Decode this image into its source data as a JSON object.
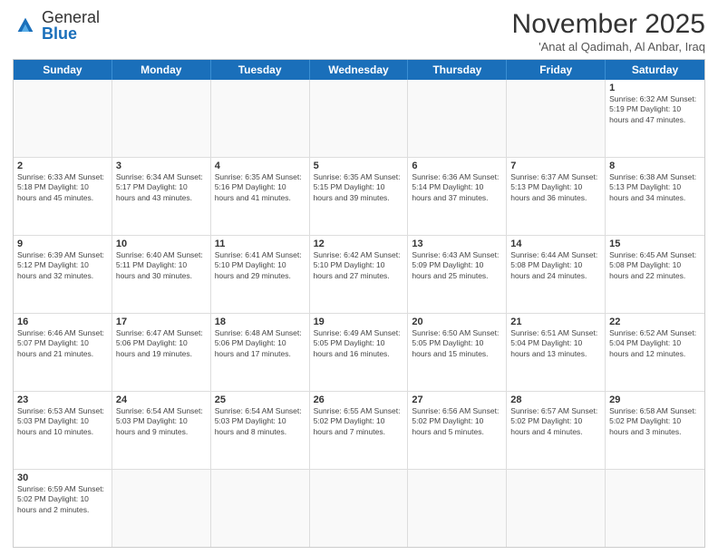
{
  "header": {
    "logo_general": "General",
    "logo_blue": "Blue",
    "month_title": "November 2025",
    "location": "'Anat al Qadimah, Al Anbar, Iraq"
  },
  "day_headers": [
    "Sunday",
    "Monday",
    "Tuesday",
    "Wednesday",
    "Thursday",
    "Friday",
    "Saturday"
  ],
  "weeks": [
    [
      {
        "num": "",
        "info": "",
        "empty": true
      },
      {
        "num": "",
        "info": "",
        "empty": true
      },
      {
        "num": "",
        "info": "",
        "empty": true
      },
      {
        "num": "",
        "info": "",
        "empty": true
      },
      {
        "num": "",
        "info": "",
        "empty": true
      },
      {
        "num": "",
        "info": "",
        "empty": true
      },
      {
        "num": "1",
        "info": "Sunrise: 6:32 AM\nSunset: 5:19 PM\nDaylight: 10 hours and 47 minutes.",
        "empty": false
      }
    ],
    [
      {
        "num": "2",
        "info": "Sunrise: 6:33 AM\nSunset: 5:18 PM\nDaylight: 10 hours and 45 minutes.",
        "empty": false
      },
      {
        "num": "3",
        "info": "Sunrise: 6:34 AM\nSunset: 5:17 PM\nDaylight: 10 hours and 43 minutes.",
        "empty": false
      },
      {
        "num": "4",
        "info": "Sunrise: 6:35 AM\nSunset: 5:16 PM\nDaylight: 10 hours and 41 minutes.",
        "empty": false
      },
      {
        "num": "5",
        "info": "Sunrise: 6:35 AM\nSunset: 5:15 PM\nDaylight: 10 hours and 39 minutes.",
        "empty": false
      },
      {
        "num": "6",
        "info": "Sunrise: 6:36 AM\nSunset: 5:14 PM\nDaylight: 10 hours and 37 minutes.",
        "empty": false
      },
      {
        "num": "7",
        "info": "Sunrise: 6:37 AM\nSunset: 5:13 PM\nDaylight: 10 hours and 36 minutes.",
        "empty": false
      },
      {
        "num": "8",
        "info": "Sunrise: 6:38 AM\nSunset: 5:13 PM\nDaylight: 10 hours and 34 minutes.",
        "empty": false
      }
    ],
    [
      {
        "num": "9",
        "info": "Sunrise: 6:39 AM\nSunset: 5:12 PM\nDaylight: 10 hours and 32 minutes.",
        "empty": false
      },
      {
        "num": "10",
        "info": "Sunrise: 6:40 AM\nSunset: 5:11 PM\nDaylight: 10 hours and 30 minutes.",
        "empty": false
      },
      {
        "num": "11",
        "info": "Sunrise: 6:41 AM\nSunset: 5:10 PM\nDaylight: 10 hours and 29 minutes.",
        "empty": false
      },
      {
        "num": "12",
        "info": "Sunrise: 6:42 AM\nSunset: 5:10 PM\nDaylight: 10 hours and 27 minutes.",
        "empty": false
      },
      {
        "num": "13",
        "info": "Sunrise: 6:43 AM\nSunset: 5:09 PM\nDaylight: 10 hours and 25 minutes.",
        "empty": false
      },
      {
        "num": "14",
        "info": "Sunrise: 6:44 AM\nSunset: 5:08 PM\nDaylight: 10 hours and 24 minutes.",
        "empty": false
      },
      {
        "num": "15",
        "info": "Sunrise: 6:45 AM\nSunset: 5:08 PM\nDaylight: 10 hours and 22 minutes.",
        "empty": false
      }
    ],
    [
      {
        "num": "16",
        "info": "Sunrise: 6:46 AM\nSunset: 5:07 PM\nDaylight: 10 hours and 21 minutes.",
        "empty": false
      },
      {
        "num": "17",
        "info": "Sunrise: 6:47 AM\nSunset: 5:06 PM\nDaylight: 10 hours and 19 minutes.",
        "empty": false
      },
      {
        "num": "18",
        "info": "Sunrise: 6:48 AM\nSunset: 5:06 PM\nDaylight: 10 hours and 17 minutes.",
        "empty": false
      },
      {
        "num": "19",
        "info": "Sunrise: 6:49 AM\nSunset: 5:05 PM\nDaylight: 10 hours and 16 minutes.",
        "empty": false
      },
      {
        "num": "20",
        "info": "Sunrise: 6:50 AM\nSunset: 5:05 PM\nDaylight: 10 hours and 15 minutes.",
        "empty": false
      },
      {
        "num": "21",
        "info": "Sunrise: 6:51 AM\nSunset: 5:04 PM\nDaylight: 10 hours and 13 minutes.",
        "empty": false
      },
      {
        "num": "22",
        "info": "Sunrise: 6:52 AM\nSunset: 5:04 PM\nDaylight: 10 hours and 12 minutes.",
        "empty": false
      }
    ],
    [
      {
        "num": "23",
        "info": "Sunrise: 6:53 AM\nSunset: 5:03 PM\nDaylight: 10 hours and 10 minutes.",
        "empty": false
      },
      {
        "num": "24",
        "info": "Sunrise: 6:54 AM\nSunset: 5:03 PM\nDaylight: 10 hours and 9 minutes.",
        "empty": false
      },
      {
        "num": "25",
        "info": "Sunrise: 6:54 AM\nSunset: 5:03 PM\nDaylight: 10 hours and 8 minutes.",
        "empty": false
      },
      {
        "num": "26",
        "info": "Sunrise: 6:55 AM\nSunset: 5:02 PM\nDaylight: 10 hours and 7 minutes.",
        "empty": false
      },
      {
        "num": "27",
        "info": "Sunrise: 6:56 AM\nSunset: 5:02 PM\nDaylight: 10 hours and 5 minutes.",
        "empty": false
      },
      {
        "num": "28",
        "info": "Sunrise: 6:57 AM\nSunset: 5:02 PM\nDaylight: 10 hours and 4 minutes.",
        "empty": false
      },
      {
        "num": "29",
        "info": "Sunrise: 6:58 AM\nSunset: 5:02 PM\nDaylight: 10 hours and 3 minutes.",
        "empty": false
      }
    ],
    [
      {
        "num": "30",
        "info": "Sunrise: 6:59 AM\nSunset: 5:02 PM\nDaylight: 10 hours and 2 minutes.",
        "empty": false
      },
      {
        "num": "",
        "info": "",
        "empty": true
      },
      {
        "num": "",
        "info": "",
        "empty": true
      },
      {
        "num": "",
        "info": "",
        "empty": true
      },
      {
        "num": "",
        "info": "",
        "empty": true
      },
      {
        "num": "",
        "info": "",
        "empty": true
      },
      {
        "num": "",
        "info": "",
        "empty": true
      }
    ]
  ]
}
